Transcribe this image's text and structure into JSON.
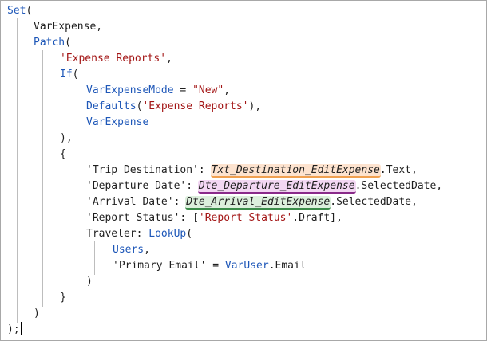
{
  "code": {
    "l1": {
      "fn": "Set",
      "open": "("
    },
    "l2": {
      "var": "VarExpense",
      "comma": ","
    },
    "l3": {
      "fn": "Patch",
      "open": "("
    },
    "l4": {
      "str": "'Expense Reports'",
      "comma": ","
    },
    "l5": {
      "kw": "If",
      "open": "("
    },
    "l6": {
      "var": "VarExpenseMode",
      "op": " = ",
      "str": "\"New\"",
      "comma": ","
    },
    "l7": {
      "fn": "Defaults",
      "open": "(",
      "str": "'Expense Reports'",
      "close": "),"
    },
    "l8": {
      "var": "VarExpense"
    },
    "l9": {
      "text": "),"
    },
    "l10": {
      "text": "{"
    },
    "l11": {
      "field": "'Trip Destination':",
      "control": "Txt_Destination_EditExpense",
      "prop": ".Text,"
    },
    "l12": {
      "field": "'Departure Date':",
      "control": "Dte_Departure_EditExpense",
      "prop": ".SelectedDate,"
    },
    "l13": {
      "field": "'Arrival Date':",
      "control": "Dte_Arrival_EditExpense",
      "prop": ".SelectedDate,"
    },
    "l14": {
      "field": "'Report Status':",
      "open": "[",
      "str": "'Report Status'",
      "suffix": ".Draft],"
    },
    "l15": {
      "field": "Traveler:",
      "fn": "LookUp",
      "open": "("
    },
    "l16": {
      "var": "Users",
      "comma": ","
    },
    "l17": {
      "field": "'Primary Email'",
      "op": " = ",
      "var": "VarUser",
      "suffix": ".Email"
    },
    "l18": {
      "text": ")"
    },
    "l19": {
      "text": "}"
    },
    "l20": {
      "text": ")"
    },
    "l21": {
      "text": ");"
    }
  },
  "highlights": {
    "orange": "#f0a050",
    "purple": "#8a2a8a",
    "green": "#3c8c4a"
  }
}
